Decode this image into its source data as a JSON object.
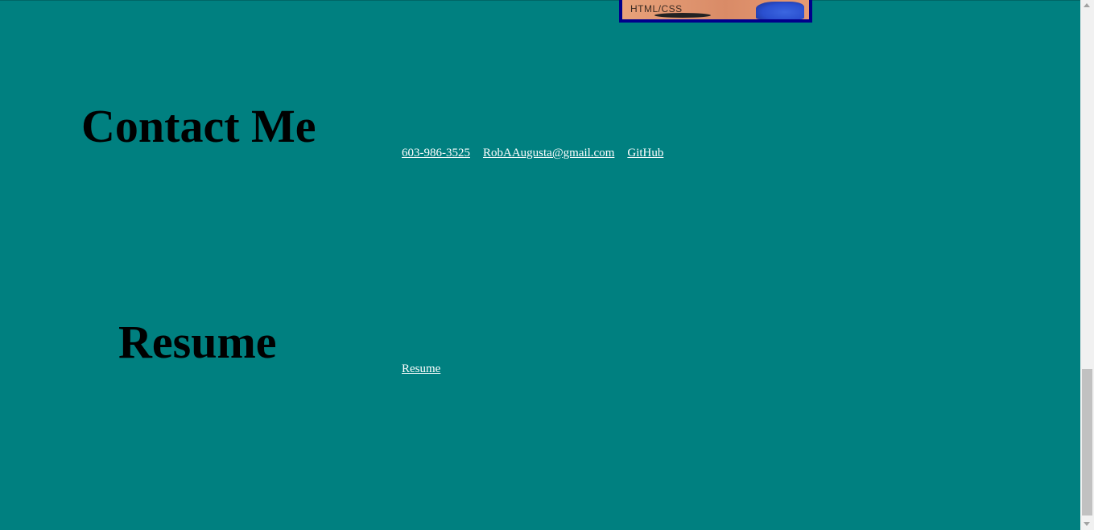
{
  "project_thumbnail": {
    "caption": "HTML/CSS"
  },
  "contact": {
    "heading": "Contact Me",
    "links": [
      {
        "label": "603-986-3525"
      },
      {
        "label": "RobAAugusta@gmail.com"
      },
      {
        "label": "GitHub"
      }
    ]
  },
  "resume": {
    "heading": "Resume",
    "link_label": "Resume"
  },
  "colors": {
    "page_background": "#008080",
    "heading_text": "#000000",
    "link_text": "#ffffff",
    "thumbnail_border": "#00008b"
  }
}
